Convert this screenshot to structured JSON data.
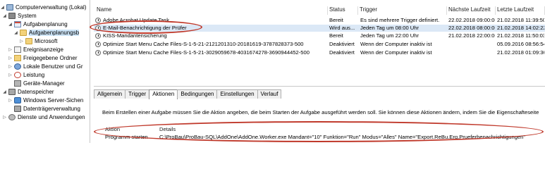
{
  "tree": {
    "items": [
      {
        "label": "Computerverwaltung (Lokal)",
        "expander": "◢",
        "icon": "computer-icon"
      },
      {
        "label": "System",
        "expander": "◢",
        "icon": "tools-icon"
      },
      {
        "label": "Aufgabenplanung",
        "expander": "◢",
        "icon": "task-scheduler-icon"
      },
      {
        "label": "Aufgabenplanungsb",
        "expander": "◢",
        "icon": "folder-icon"
      },
      {
        "label": "Microsoft",
        "expander": "▷",
        "icon": "folder-icon"
      },
      {
        "label": "Ereignisanzeige",
        "expander": "▷",
        "icon": "event-viewer-icon"
      },
      {
        "label": "Freigegebene Ordner",
        "expander": "▷",
        "icon": "shared-folder-icon"
      },
      {
        "label": "Lokale Benutzer und Gr",
        "expander": "▷",
        "icon": "users-icon"
      },
      {
        "label": "Leistung",
        "expander": "▷",
        "icon": "performance-icon"
      },
      {
        "label": "Geräte-Manager",
        "expander": "",
        "icon": "device-manager-icon"
      },
      {
        "label": "Datenspeicher",
        "expander": "◢",
        "icon": "storage-icon"
      },
      {
        "label": "Windows Server-Sichen",
        "expander": "▷",
        "icon": "backup-icon"
      },
      {
        "label": "Datenträgerverwaltung",
        "expander": "",
        "icon": "disk-icon"
      },
      {
        "label": "Dienste und Anwendungen",
        "expander": "▷",
        "icon": "services-icon"
      }
    ]
  },
  "list": {
    "columns": [
      "Name",
      "Status",
      "Trigger",
      "Nächste Laufzeit",
      "Letzte Laufzeit"
    ],
    "rows": [
      {
        "name": "Adobe Acrobat Update Task",
        "status": "Bereit",
        "trigger": "Es sind mehrere Trigger definiert.",
        "next": "22.02.2018 09:00:00",
        "last": "21.02.2018 11:39:50"
      },
      {
        "name": "E-Mail-Benachrichtigung der Prüfer",
        "status": "Wird aus...",
        "trigger": "Jeden Tag um 08:00 Uhr",
        "next": "22.02.2018 08:00:00",
        "last": "21.02.2018 14:02:22"
      },
      {
        "name": "KISS-Mandantensicherung",
        "status": "Bereit",
        "trigger": "Jeden Tag um 22:00 Uhr",
        "next": "21.02.2018 22:00:00",
        "last": "21.02.2018 11:50:03"
      },
      {
        "name": "Optimize Start Menu Cache Files-S-1-5-21-2121201310-20181619-3787828373-500",
        "status": "Deaktiviert",
        "trigger": "Wenn der Computer inaktiv ist",
        "next": "",
        "last": "05.09.2016 08:56:54"
      },
      {
        "name": "Optimize Start Menu Cache Files-S-1-5-21-3029059678-4031674278-3690944452-500",
        "status": "Deaktiviert",
        "trigger": "Wenn der Computer inaktiv ist",
        "next": "",
        "last": "21.02.2018 01:09:36"
      }
    ]
  },
  "detail": {
    "tabs": [
      "Allgemein",
      "Trigger",
      "Aktionen",
      "Bedingungen",
      "Einstellungen",
      "Verlauf"
    ],
    "info": "Beim Erstellen einer Aufgabe müssen Sie die Aktion angeben, die beim Starten der Aufgabe ausgeführt werden soll. Sie können diese Aktionen ändern, indem Sie die Eigenschafteseite",
    "action_columns": [
      "Aktion",
      "Details"
    ],
    "action_row": {
      "action": "Programm starten",
      "details": "C:\\ProBau\\ProBau-SQL\\AddOne\\AddOne.Worker.exe Mandant=\"10\" Funktion=\"Run\" Modus=\"Alles\" Name=\"Export.ReBu.Erg.Prueferbenachrichtigungen\""
    }
  },
  "colors": {
    "annotation": "#c0392b",
    "selection": "#dbe8f6",
    "tree_selection": "#cce4f7"
  }
}
